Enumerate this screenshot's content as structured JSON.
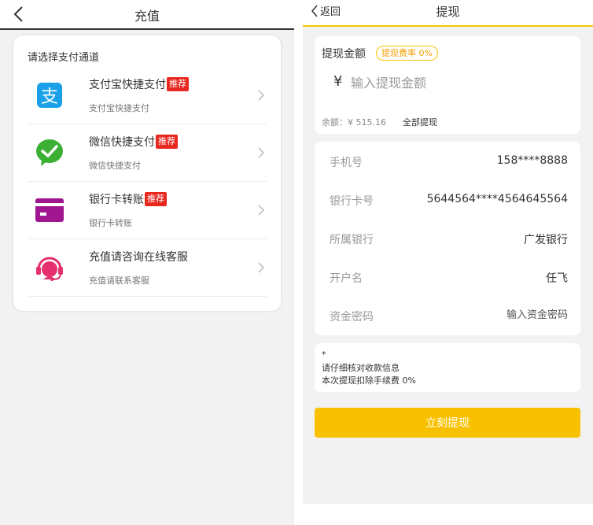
{
  "recharge": {
    "title": "充值",
    "section_title": "请选择支付通道",
    "methods": [
      {
        "name": "支付宝快捷支付",
        "badge": "推荐",
        "sub": "支付宝快捷支付",
        "icon": "alipay-icon",
        "color": "#1aa0e8"
      },
      {
        "name": "微信快捷支付",
        "badge": "推荐",
        "sub": "微信快捷支付",
        "icon": "wechat-icon",
        "color": "#3cb034"
      },
      {
        "name": "银行卡转账",
        "badge": "推荐",
        "sub": "银行卡转账",
        "icon": "bank-card-icon",
        "color": "#a0168e"
      },
      {
        "name": "充值请咨询在线客服",
        "badge": "",
        "sub": "充值请联系客服",
        "icon": "customer-service-icon",
        "color": "#e62f6f"
      }
    ]
  },
  "withdraw": {
    "back_label": "返回",
    "title": "提现",
    "amount_label": "提现金额",
    "rate_label": "提现费率 0%",
    "currency_symbol": "¥",
    "amount_placeholder": "输入提现金额",
    "balance": "余额：¥ 515.16",
    "all_withdraw": "全部提现",
    "fields": [
      {
        "label": "手机号",
        "value": "158****8888"
      },
      {
        "label": "银行卡号",
        "value": "5644564****4564645564"
      },
      {
        "label": "所属银行",
        "value": "广发银行"
      },
      {
        "label": "开户名",
        "value": "任飞"
      }
    ],
    "password_label": "资金密码",
    "password_placeholder": "输入资金密码",
    "notice_star": "*",
    "notice_line1": "请仔细核对收款信息",
    "notice_line2": "本次提现扣除手续费 0%",
    "submit_label": "立刻提现",
    "accent": "#f8c100"
  }
}
